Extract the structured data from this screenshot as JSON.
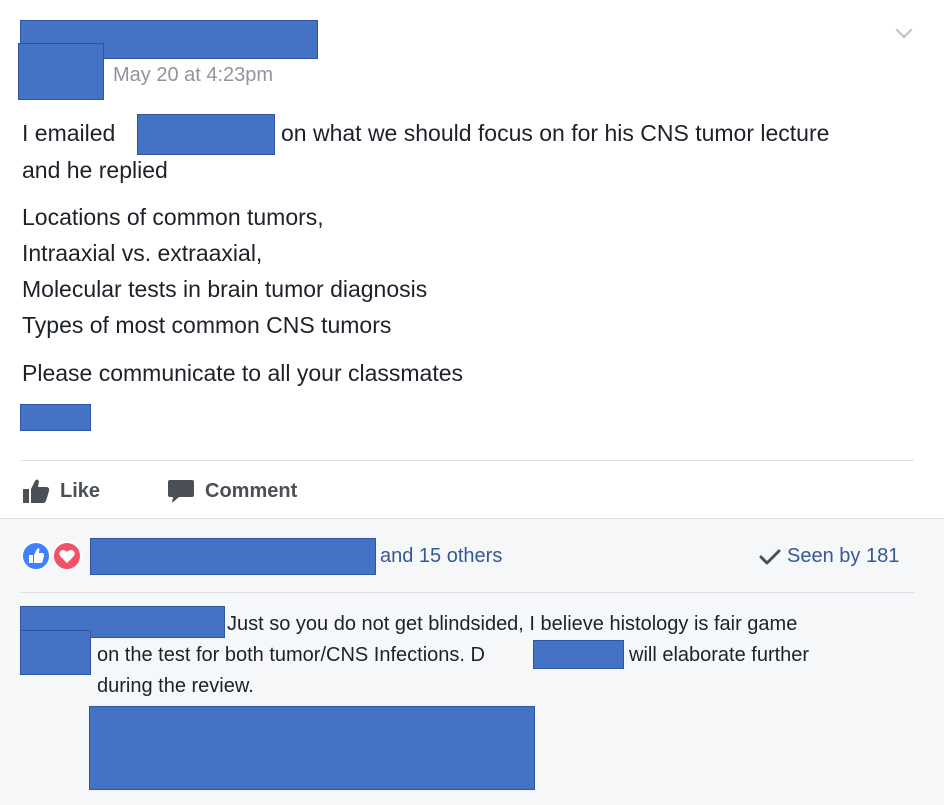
{
  "post": {
    "timestamp": "May 20 at 4:23pm",
    "line1_pre": "I emailed",
    "line1_post": "on what we should focus on for his CNS tumor lecture",
    "line2": "and he replied",
    "list": [
      "Locations of common tumors,",
      "Intraaxial vs. extraaxial,",
      "Molecular tests in brain tumor diagnosis",
      "Types of most common CNS tumors"
    ],
    "closing": "Please communicate to all your classmates"
  },
  "actions": {
    "like": "Like",
    "comment": "Comment"
  },
  "reactions": {
    "others": "and 15 others",
    "seen": "Seen by 181"
  },
  "comment": {
    "line1": "Just so you do not get blindsided, I believe histology is fair game",
    "line2_pre": "on the test for both tumor/CNS Infections. D",
    "line2_post": "will elaborate further",
    "line3": "during the review."
  },
  "icons": [
    "chevron-down-icon",
    "thumbs-up-icon",
    "comment-bubble-icon",
    "like-reaction-icon",
    "love-reaction-icon",
    "checkmark-icon"
  ],
  "colors": {
    "redaction": "#4472c4",
    "link": "#365899",
    "like_blue": "#4080ff",
    "love_red": "#f25268"
  }
}
